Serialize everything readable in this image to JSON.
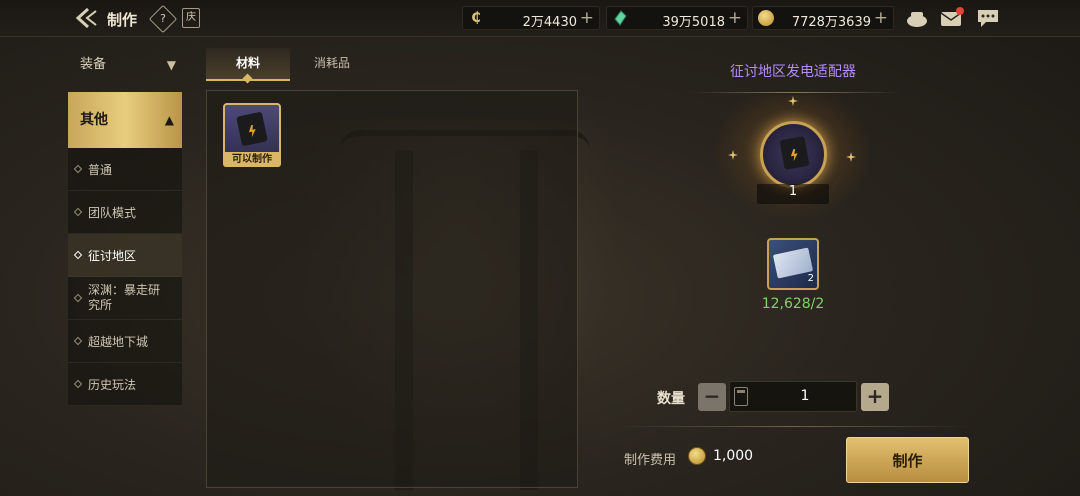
{
  "header": {
    "title": "制作",
    "help_glyph": "?",
    "calendar_glyph": "庆",
    "currencies": [
      {
        "icon": "c-coin-icon",
        "value": "2万4430",
        "color": "#d8c27a"
      },
      {
        "icon": "green-crystal-icon",
        "value": "39万5018",
        "color": "#5fd6a0"
      },
      {
        "icon": "gold-coin-icon",
        "value": "7728万3639",
        "color": "#d9b45a"
      }
    ],
    "plus": "+"
  },
  "sidebar": {
    "category": "装备",
    "active_group": "其他",
    "items": [
      {
        "label": "普通",
        "selected": false
      },
      {
        "label": "团队模式",
        "selected": false
      },
      {
        "label": "征讨地区",
        "selected": true
      },
      {
        "label": "深渊：暴走研究所",
        "selected": false
      },
      {
        "label": "超越地下城",
        "selected": false
      },
      {
        "label": "历史玩法",
        "selected": false
      }
    ]
  },
  "tabs": [
    {
      "label": "材料",
      "active": true
    },
    {
      "label": "消耗品",
      "active": false
    }
  ],
  "list": {
    "items": [
      {
        "name": "征讨地区发电适配器",
        "badge": "可以制作"
      }
    ]
  },
  "detail": {
    "title": "征讨地区发电适配器",
    "result_qty": "1",
    "material_stack": "2",
    "material_count": "12,628/2",
    "qty_label": "数量",
    "qty_value": "1",
    "minus": "−",
    "plus": "+",
    "cost_label": "制作费用",
    "cost_value": "1,000",
    "make_button": "制作"
  },
  "colors": {
    "accent_gold": "#d7b664",
    "title_purple": "#b58cff",
    "count_green": "#7fd36a"
  }
}
